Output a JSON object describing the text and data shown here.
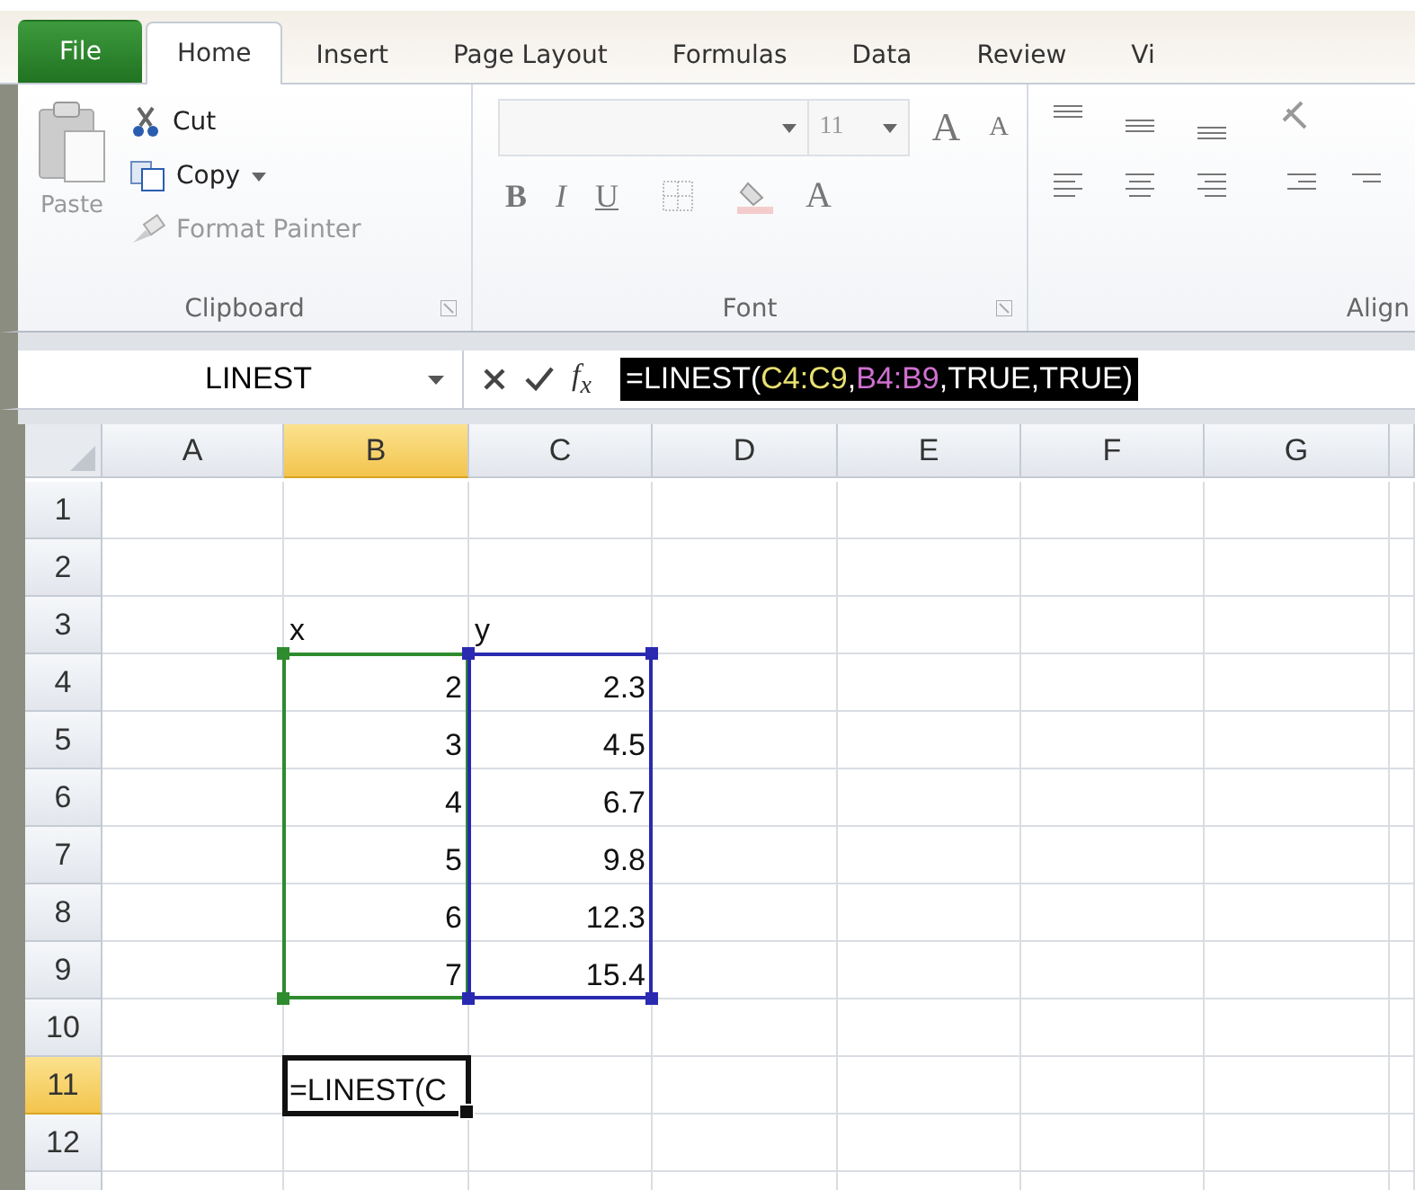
{
  "ribbon_tabs": [
    {
      "label": "File",
      "kind": "file",
      "selected": false
    },
    {
      "label": "Home",
      "kind": "tab",
      "selected": true
    },
    {
      "label": "Insert",
      "kind": "tab",
      "selected": false
    },
    {
      "label": "Page Layout",
      "kind": "tab",
      "selected": false
    },
    {
      "label": "Formulas",
      "kind": "tab",
      "selected": false
    },
    {
      "label": "Data",
      "kind": "tab",
      "selected": false
    },
    {
      "label": "Review",
      "kind": "tab",
      "selected": false
    },
    {
      "label": "Vi",
      "kind": "tab",
      "selected": false
    }
  ],
  "clipboard": {
    "title": "Clipboard",
    "paste": "Paste",
    "items": [
      {
        "label": "Cut",
        "kind": "cut",
        "disabled": false,
        "dropdown": false
      },
      {
        "label": "Copy",
        "kind": "copy",
        "disabled": false,
        "dropdown": true
      },
      {
        "label": "Format Painter",
        "kind": "painter",
        "disabled": true,
        "dropdown": false
      }
    ]
  },
  "font": {
    "title": "Font",
    "size": "11",
    "grow": "A",
    "shrink": "A",
    "format_buttons": [
      {
        "label": "B",
        "kind": "bold"
      },
      {
        "label": "I",
        "kind": "italic"
      },
      {
        "label": "U",
        "kind": "underline"
      }
    ],
    "font_color": "A"
  },
  "alignment": {
    "title": "Align"
  },
  "formula_bar": {
    "name_box": "LINEST",
    "function_label": "f$_{x}$",
    "formula": [
      {
        "text": "=LINEST("
      },
      {
        "text": "C4:C9",
        "color": "#e8e070"
      },
      {
        "text": ","
      },
      {
        "text": "B4:B9",
        "color": "#d070d0"
      },
      {
        "text": ",TRUE,TRUE)"
      }
    ]
  },
  "columns": [
    {
      "label": "A",
      "selected": false
    },
    {
      "label": "B",
      "selected": true
    },
    {
      "label": "C",
      "selected": false
    },
    {
      "label": "D",
      "selected": false
    },
    {
      "label": "E",
      "selected": false
    },
    {
      "label": "F",
      "selected": false
    },
    {
      "label": "G",
      "selected": false
    }
  ],
  "rows": [
    {
      "label": "1",
      "selected": false,
      "cells": [
        {},
        {},
        {}
      ]
    },
    {
      "label": "2",
      "selected": false,
      "cells": [
        {},
        {},
        {}
      ]
    },
    {
      "label": "3",
      "selected": false,
      "cells": [
        {},
        {
          "text": "x"
        },
        {
          "text": "y"
        }
      ]
    },
    {
      "label": "4",
      "selected": false,
      "cells": [
        {},
        {
          "text": "2",
          "numeric": true,
          "color": "#2e8b2e"
        },
        {
          "text": "2.3",
          "numeric": true,
          "color": "#2a2ab0"
        }
      ]
    },
    {
      "label": "5",
      "selected": false,
      "cells": [
        {},
        {
          "text": "3",
          "numeric": true,
          "color": "#2e8b2e"
        },
        {
          "text": "4.5",
          "numeric": true,
          "color": "#2a2ab0"
        }
      ]
    },
    {
      "label": "6",
      "selected": false,
      "cells": [
        {},
        {
          "text": "4",
          "numeric": true,
          "color": "#2e8b2e"
        },
        {
          "text": "6.7",
          "numeric": true,
          "color": "#2a2ab0"
        }
      ]
    },
    {
      "label": "7",
      "selected": false,
      "cells": [
        {},
        {
          "text": "5",
          "numeric": true,
          "color": "#2e8b2e"
        },
        {
          "text": "9.8",
          "numeric": true,
          "color": "#2a2ab0"
        }
      ]
    },
    {
      "label": "8",
      "selected": false,
      "cells": [
        {},
        {
          "text": "6",
          "numeric": true,
          "color": "#2e8b2e"
        },
        {
          "text": "12.3",
          "numeric": true,
          "color": "#2a2ab0"
        }
      ]
    },
    {
      "label": "9",
      "selected": false,
      "cells": [
        {},
        {
          "text": "7",
          "numeric": true,
          "color": "#2e8b2e"
        },
        {
          "text": "15.4",
          "numeric": true,
          "color": "#2a2ab0"
        }
      ]
    },
    {
      "label": "10",
      "selected": false,
      "cells": [
        {},
        {},
        {}
      ]
    },
    {
      "label": "11",
      "selected": true,
      "cells": [
        {},
        {
          "text": "=LINEST(C",
          "active": true
        },
        {}
      ]
    },
    {
      "label": "12",
      "selected": false,
      "cells": [
        {},
        {},
        {}
      ]
    },
    {
      "label": "",
      "selected": false,
      "cells": [
        {},
        {},
        {}
      ]
    }
  ]
}
